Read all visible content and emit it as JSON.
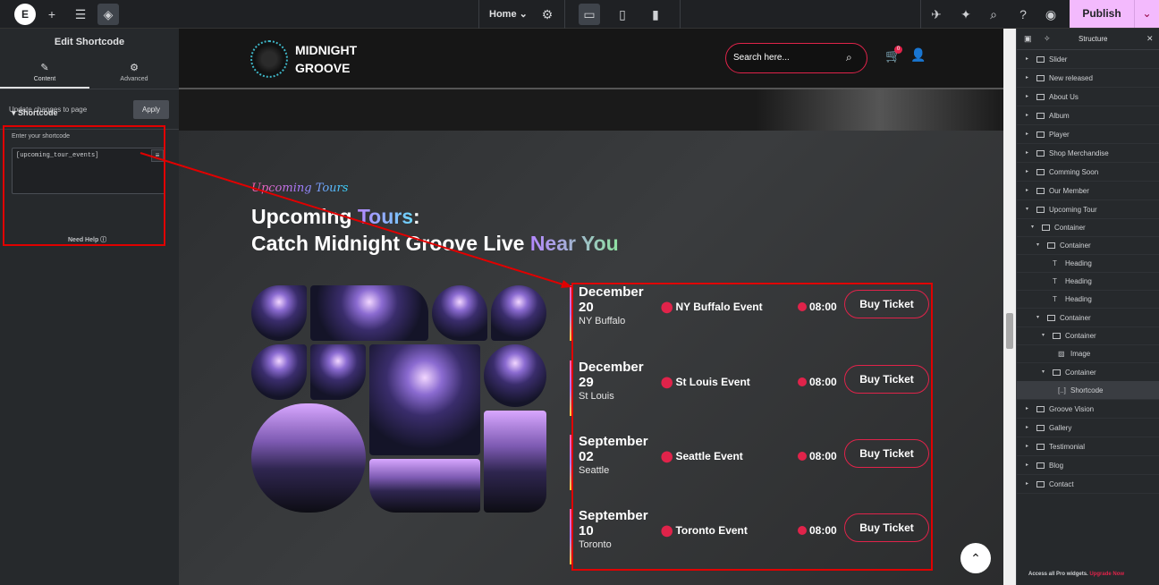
{
  "topbar": {
    "logo": "E",
    "icons": [
      "plus-icon",
      "sliders-icon",
      "layers-icon"
    ],
    "page_select": "Home",
    "publish_label": "Publish"
  },
  "left_panel": {
    "title": "Edit Shortcode",
    "tab_content": "Content",
    "tab_advanced": "Advanced",
    "update_text": "Update changes to page",
    "apply_label": "Apply",
    "section_title": "Shortcode",
    "field_label": "Enter your shortcode",
    "field_value": "[upcoming_tour_events]",
    "help_label": "Need Help"
  },
  "site": {
    "logo_line1": "MIDNIGHT",
    "logo_line2": "GROOVE",
    "search_placeholder": "Search here...",
    "cart_count": "0",
    "subtitle": "Upcoming Tours",
    "headline_a": "Upcoming ",
    "headline_b": "Tours",
    "headline_c": ":",
    "headline_d": "Catch Midnight Groove Live ",
    "headline_e": "Near You"
  },
  "events": [
    {
      "month": "December",
      "day": "20",
      "city": "NY Buffalo",
      "name": "NY Buffalo Event",
      "time": "08:00",
      "button": "Buy Ticket"
    },
    {
      "month": "December",
      "day": "29",
      "city": "St Louis",
      "name": "St Louis Event",
      "time": "08:00",
      "button": "Buy Ticket"
    },
    {
      "month": "September",
      "day": "02",
      "city": "Seattle",
      "name": "Seattle Event",
      "time": "08:00",
      "button": "Buy Ticket"
    },
    {
      "month": "September",
      "day": "10",
      "city": "Toronto",
      "name": "Toronto Event",
      "time": "08:00",
      "button": "Buy Ticket"
    }
  ],
  "structure": {
    "title": "Structure",
    "items": [
      {
        "label": "Slider"
      },
      {
        "label": "New released"
      },
      {
        "label": "About Us"
      },
      {
        "label": "Album"
      },
      {
        "label": "Player"
      },
      {
        "label": "Shop Merchandise"
      },
      {
        "label": "Comming Soon"
      },
      {
        "label": "Our Member"
      },
      {
        "label": "Upcoming Tour"
      },
      {
        "label": "Container"
      },
      {
        "label": "Container"
      },
      {
        "label": "Heading"
      },
      {
        "label": "Heading"
      },
      {
        "label": "Heading"
      },
      {
        "label": "Container"
      },
      {
        "label": "Container"
      },
      {
        "label": "Image"
      },
      {
        "label": "Container"
      },
      {
        "label": "Shortcode"
      },
      {
        "label": "Groove Vision"
      },
      {
        "label": "Gallery"
      },
      {
        "label": "Testimonial"
      },
      {
        "label": "Blog"
      },
      {
        "label": "Contact"
      }
    ],
    "footer_text": "Access all Pro widgets.",
    "footer_link": "Upgrade Now"
  },
  "colors": {
    "accent": "#e0234a",
    "publish": "#f3bafd",
    "highlight_box": "#e00000"
  }
}
